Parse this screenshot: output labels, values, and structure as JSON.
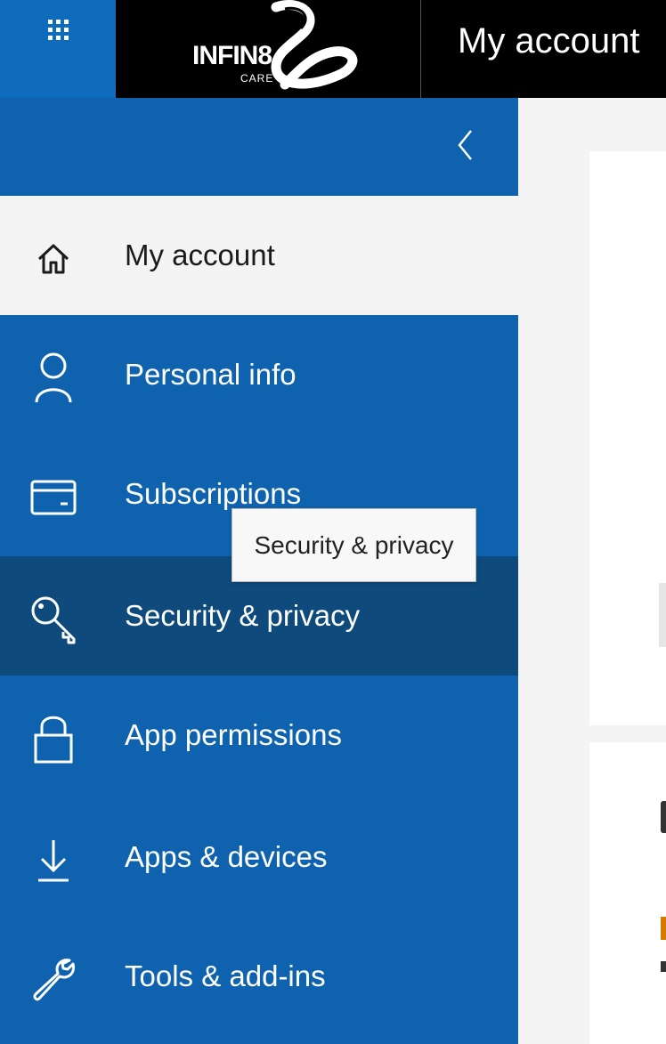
{
  "header": {
    "app_title": "My account",
    "logo_brand": "INFIN8",
    "logo_sub": "CARE",
    "waffle_icon": "app-launcher-icon"
  },
  "sidebar": {
    "collapse_icon": "chevron-left-icon",
    "items": [
      {
        "label": "My account",
        "icon": "home-icon",
        "state": "selected"
      },
      {
        "label": "Personal info",
        "icon": "person-icon",
        "state": "normal"
      },
      {
        "label": "Subscriptions",
        "icon": "credit-card-icon",
        "state": "normal"
      },
      {
        "label": "Security & privacy",
        "icon": "key-icon",
        "state": "hovered"
      },
      {
        "label": "App permissions",
        "icon": "lock-icon",
        "state": "normal"
      },
      {
        "label": "Apps & devices",
        "icon": "download-icon",
        "state": "normal"
      },
      {
        "label": "Tools & add-ins",
        "icon": "wrench-icon",
        "state": "normal"
      }
    ]
  },
  "tooltip": {
    "text": "Security & privacy"
  },
  "colors": {
    "brand_blue": "#0f62ae",
    "launcher_blue": "#0f6cbd",
    "hover_blue": "#0f4a7c",
    "selected_bg": "#f4f4f4",
    "topbar": "#000000"
  }
}
